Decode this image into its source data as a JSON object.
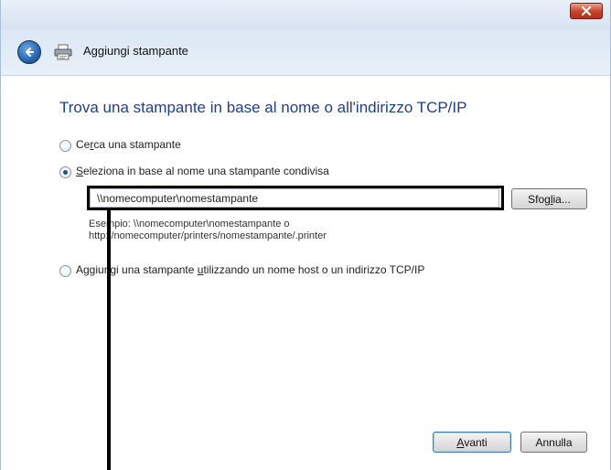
{
  "window": {
    "title": "Aggiungi stampante"
  },
  "page": {
    "heading": "Trova una stampante in base al nome o all'indirizzo TCP/IP"
  },
  "options": {
    "find_printer": {
      "label_pre": "Ce",
      "label_u": "r",
      "label_post": "ca una stampante",
      "selected": false
    },
    "select_shared": {
      "label_pre": "",
      "label_u": "S",
      "label_post": "eleziona in base al nome una stampante condivisa",
      "selected": true
    },
    "add_tcpip": {
      "label_pre": "Aggiungi una stampante ",
      "label_u": "u",
      "label_post": "tilizzando un nome host o un indirizzo TCP/IP",
      "selected": false
    }
  },
  "shared_path": {
    "value": "\\\\nomecomputer\\nomestampante"
  },
  "browse_button": {
    "label_pre": "Sfog",
    "label_u": "l",
    "label_post": "ia..."
  },
  "example": {
    "line1": "Esempio: \\\\nomecomputer\\nomestampante o",
    "line2": "http://nomecomputer/printers/nomestampante/.printer"
  },
  "footer": {
    "next": {
      "label_u": "A",
      "label_post": "vanti"
    },
    "cancel": {
      "label": "Annulla"
    }
  },
  "colors": {
    "heading": "#1f3f8c",
    "close_button": "#c7412a",
    "highlight_border": "#000000"
  }
}
